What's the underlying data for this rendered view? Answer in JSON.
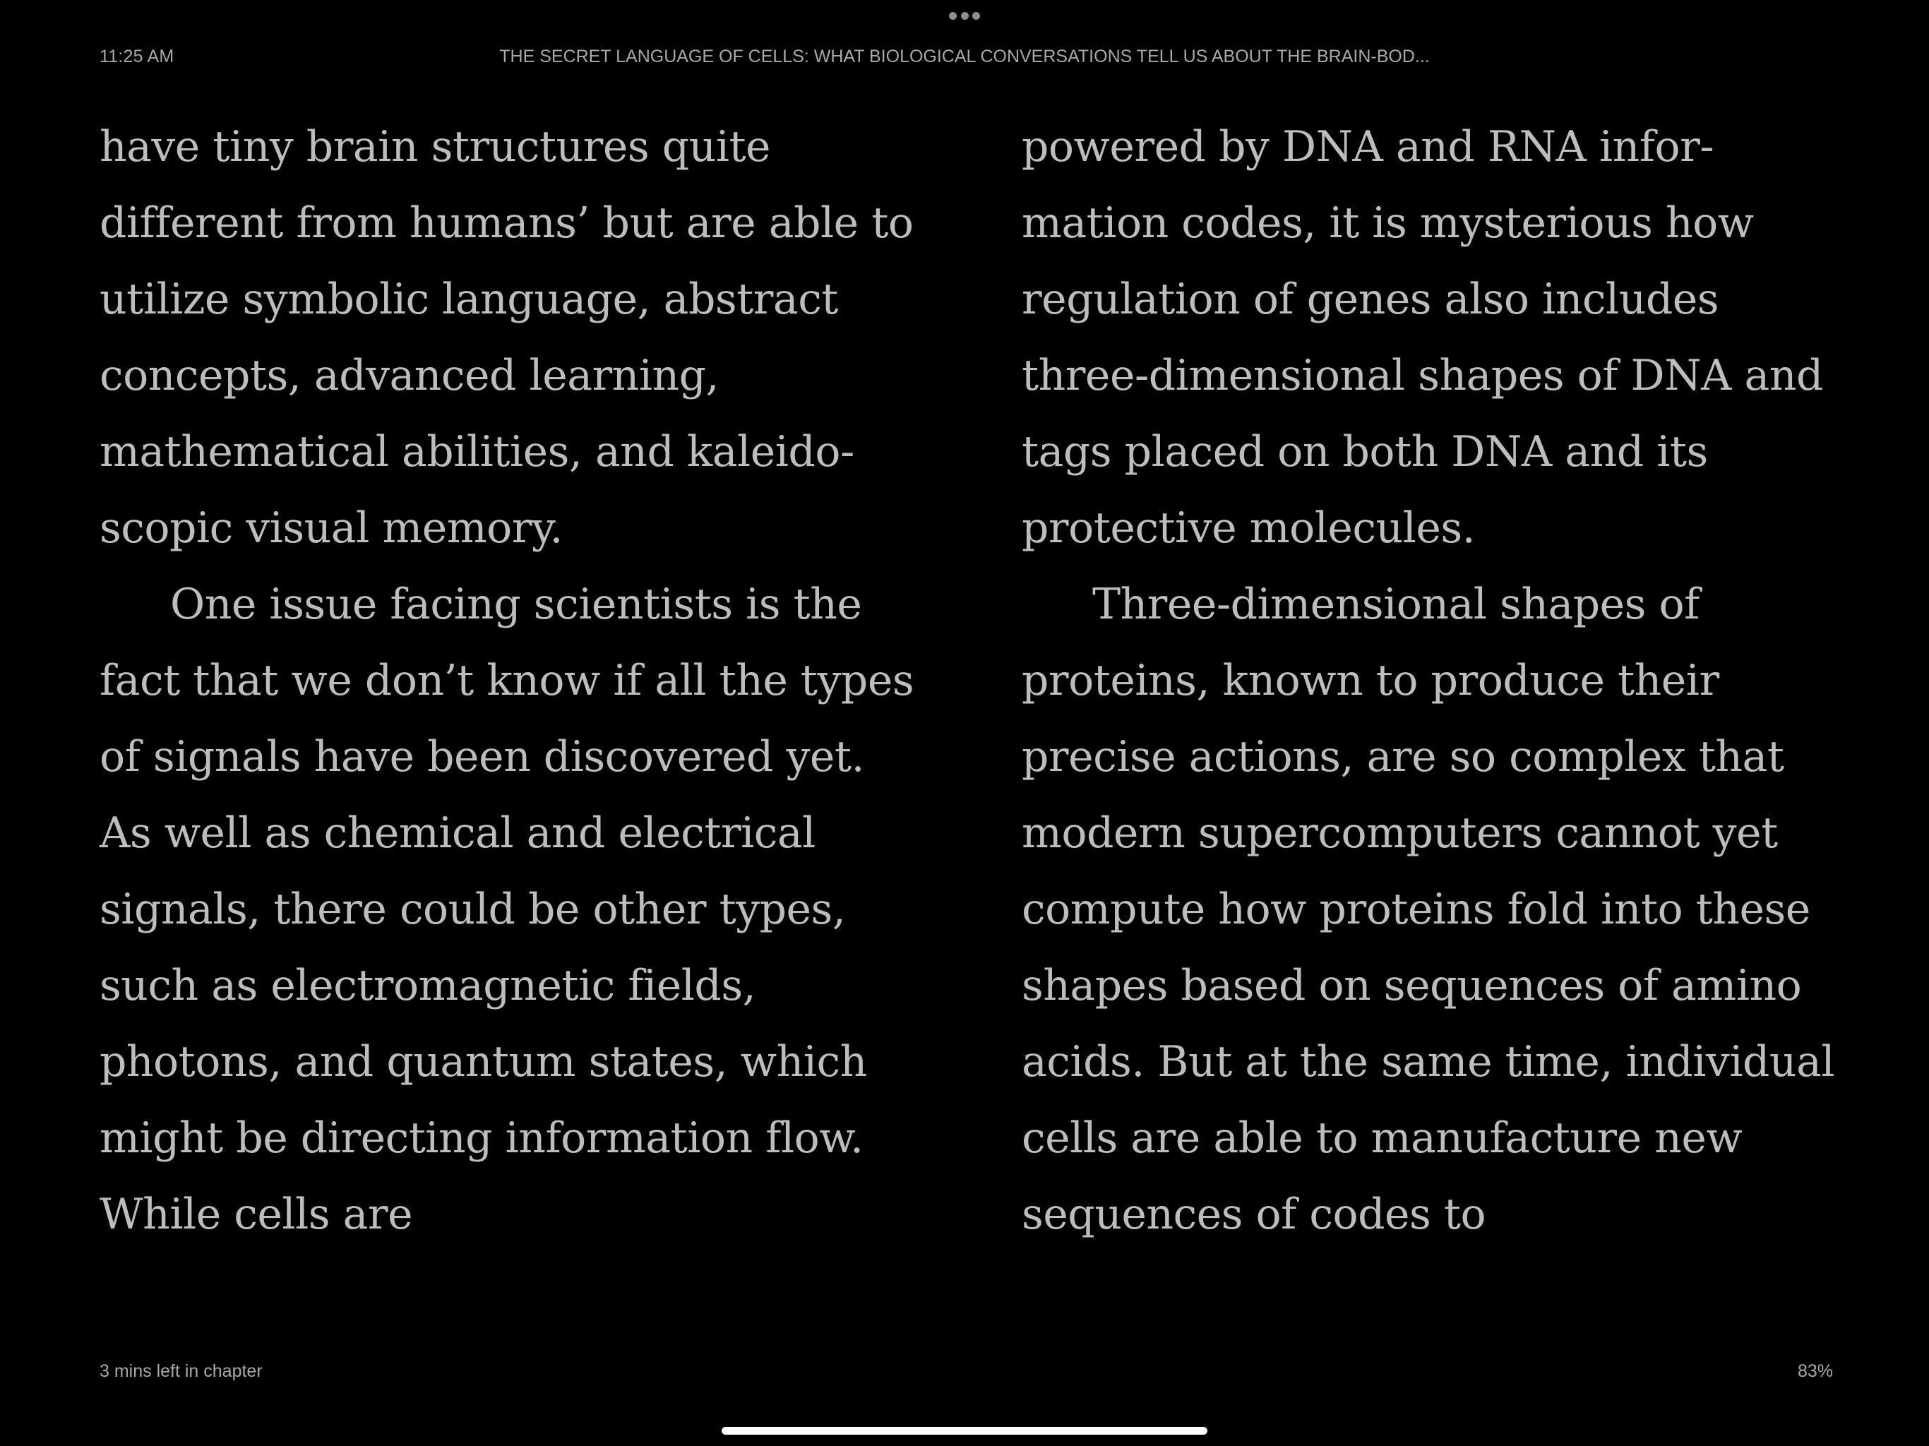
{
  "status_bar": {
    "time": "11:25 AM",
    "book_title": "THE SECRET LANGUAGE OF CELLS: WHAT BIOLOGICAL CONVERSATIONS TELL US ABOUT THE BRAIN-BOD..."
  },
  "left_page": {
    "paragraphs": [
      "have tiny brain structures quite different from humans’ but are able to utilize symbolic language, ab­stract concepts, advanced learning, mathematical abilities, and kaleido­scopic visual memory.",
      "One issue facing scientists is the fact that we don’t know if all the types of signals have been discovered yet. As well as chemical and electrical signals, there could be other types, such as electromag­netic fields, photons, and quantum states, which might be directing information flow. While cells are"
    ]
  },
  "right_page": {
    "paragraphs": [
      "powered by DNA and RNA infor­mation codes, it is mysterious how regulation of genes also includes three-dimensional shapes of DNA and tags placed on both DNA and its protective molecules.",
      "Three-dimensional shapes of proteins, known to produce their precise actions, are so complex that modern supercomputers cannot yet compute how proteins fold into these shapes based on sequences of amino acids. But at the same time, individual cells are able to manu­facture new sequences of codes to"
    ]
  },
  "footer": {
    "chapter_time_left": "3 mins left in chapter",
    "progress": "83%"
  },
  "icons": {
    "multitask": "more-dots-icon",
    "home": "home-indicator"
  }
}
